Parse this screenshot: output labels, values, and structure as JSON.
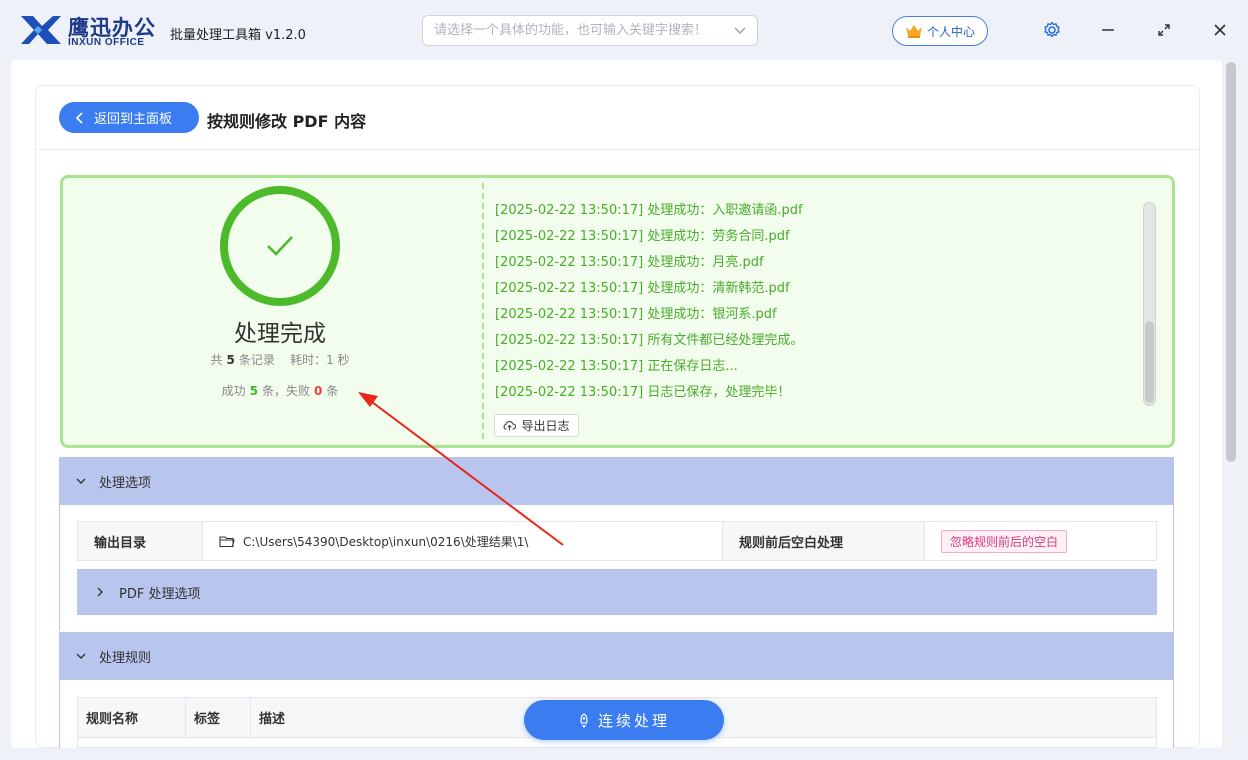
{
  "app": {
    "brand_cn": "鹰迅办公",
    "brand_en": "INXUN OFFICE",
    "title": "批量处理工具箱 v1.2.0",
    "search_placeholder": "请选择一个具体的功能，也可输入关键字搜索！",
    "user_center": "个人中心"
  },
  "page": {
    "back_label": "返回到主面板",
    "title": "按规则修改 PDF 内容"
  },
  "result": {
    "status": "处理完成",
    "total_prefix": "共",
    "total_count": "5",
    "total_suffix": "条记录",
    "time_prefix": "耗时：",
    "time_value": "1 秒",
    "success_prefix": "成功",
    "success_count": "5",
    "fail_prefix": "条，失败",
    "fail_count": "0",
    "fail_suffix": "条",
    "export_label": "导出日志",
    "log": [
      "[2025-02-22 13:50:17] 处理成功：入职邀请函.pdf",
      "[2025-02-22 13:50:17] 处理成功：劳务合同.pdf",
      "[2025-02-22 13:50:17] 处理成功：月亮.pdf",
      "[2025-02-22 13:50:17] 处理成功：清新韩范.pdf",
      "[2025-02-22 13:50:17] 处理成功：银河系.pdf",
      "[2025-02-22 13:50:17] 所有文件都已经处理完成。",
      "[2025-02-22 13:50:17] 正在保存日志...",
      "[2025-02-22 13:50:17] 日志已保存，处理完毕！"
    ]
  },
  "options": {
    "section_title": "处理选项",
    "output_dir_label": "输出目录",
    "output_dir_value": "C:\\Users\\54390\\Desktop\\inxun\\0216\\处理结果\\1\\",
    "whitespace_label": "规则前后空白处理",
    "whitespace_value": "忽略规则前后的空白",
    "pdf_options_label": "PDF 处理选项"
  },
  "rules": {
    "section_title": "处理规则",
    "columns": [
      "规则名称",
      "标签",
      "描述"
    ]
  },
  "continue_label": "连续处理",
  "colors": {
    "accent": "#3b7cf1",
    "success": "#4cba2a",
    "fail": "#f0413a",
    "section": "#b8c6ee"
  }
}
